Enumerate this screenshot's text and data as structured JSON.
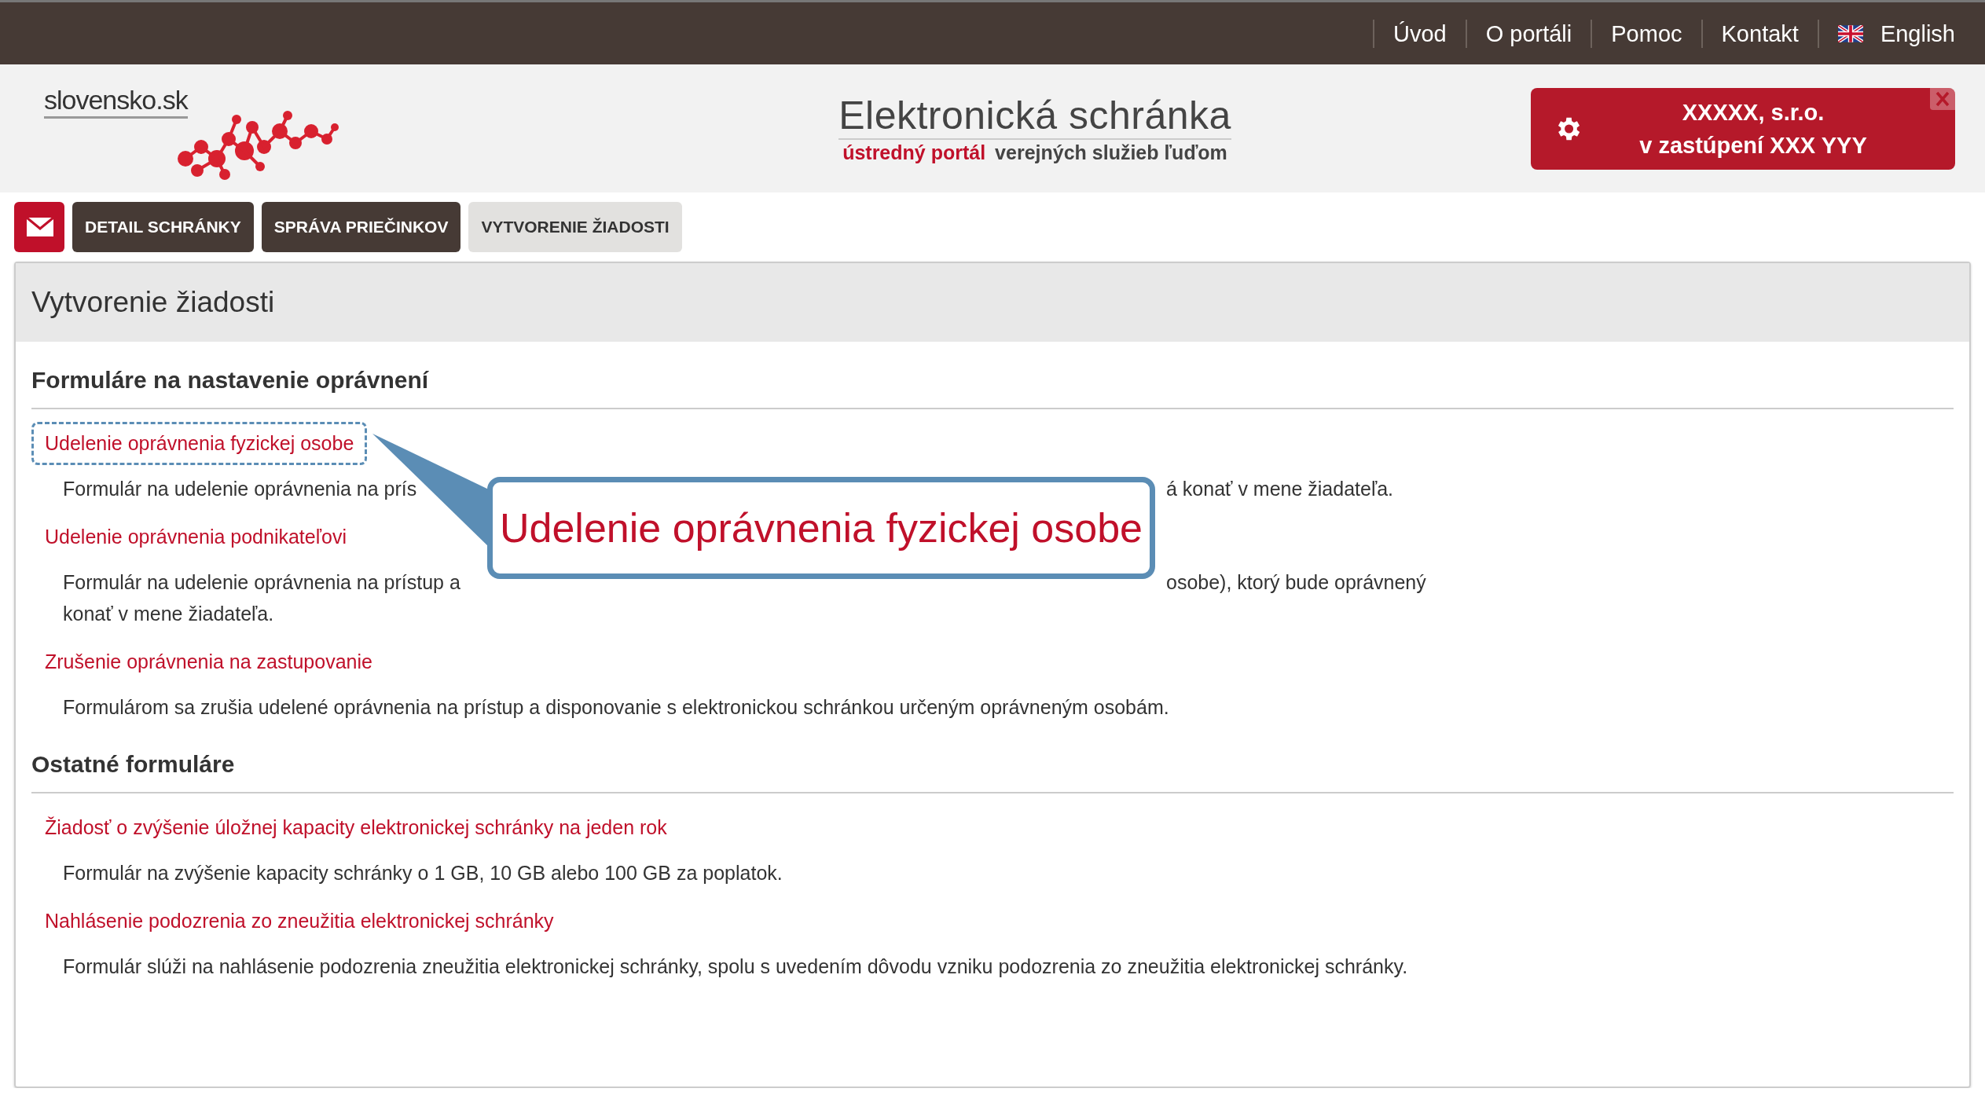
{
  "top_nav": [
    {
      "label": "Úvod",
      "kind": "link"
    },
    {
      "label": "O portáli",
      "kind": "link"
    },
    {
      "label": "Pomoc",
      "kind": "link"
    },
    {
      "label": "Kontakt",
      "kind": "link"
    },
    {
      "label": "English",
      "kind": "language"
    }
  ],
  "header": {
    "logo_text": "slovensko.sk",
    "title": "Elektronická schránka",
    "subtitle_highlight": "ústredný portál",
    "subtitle_rest": "verejných služieb ľuďom"
  },
  "account_box": {
    "lines": [
      "XXXXX, s.r.o.",
      "v zastúpení XXX YYY"
    ]
  },
  "tabs": [
    {
      "label": "DETAIL SCHRÁNKY",
      "selected": false
    },
    {
      "label": "SPRÁVA PRIEČINKOV",
      "selected": false
    },
    {
      "label": "VYTVORENIE ŽIADOSTI",
      "selected": true
    }
  ],
  "panel": {
    "title": "Vytvorenie žiadosti",
    "sections": [
      {
        "heading": "Formuláre na nastavenie oprávnení",
        "forms": [
          {
            "link": "Udelenie oprávnenia fyzickej osobe",
            "description": [
              [
                "Formulár na udelenie oprávnenia na prís",
                "á konať v mene žiadateľa."
              ]
            ],
            "focused": true
          },
          {
            "link": "Udelenie oprávnenia podnikateľovi",
            "description": [
              [
                "Formulár na udelenie oprávnenia na prístup a",
                "osobe), ktorý bude oprávnený"
              ],
              [
                "konať v mene žiadateľa."
              ]
            ],
            "focused": false
          },
          {
            "link": "Zrušenie oprávnenia na zastupovanie",
            "description": [
              [
                "Formulárom sa zrušia udelené oprávnenia na prístup a disponovanie s elektronickou schránkou určeným oprávneným osobám."
              ]
            ],
            "focused": false
          }
        ]
      },
      {
        "heading": "Ostatné formuláre",
        "forms": [
          {
            "link": "Žiadosť o zvýšenie úložnej kapacity elektronickej schránky na jeden rok",
            "description": [
              [
                "Formulár na zvýšenie kapacity schránky o 1 GB, 10 GB alebo 100 GB za poplatok."
              ]
            ],
            "focused": false
          },
          {
            "link": "Nahlásenie podozrenia zo zneužitia elektronickej schránky",
            "description": [
              [
                "Formulár slúži na nahlásenie podozrenia zneužitia elektronickej schránky, spolu s uvedením dôvodu vzniku podozrenia zo zneužitia elektronickej schránky."
              ]
            ],
            "focused": false
          }
        ]
      }
    ],
    "callout": {
      "text": "Udelenie oprávnenia fyzickej osobe"
    }
  }
}
